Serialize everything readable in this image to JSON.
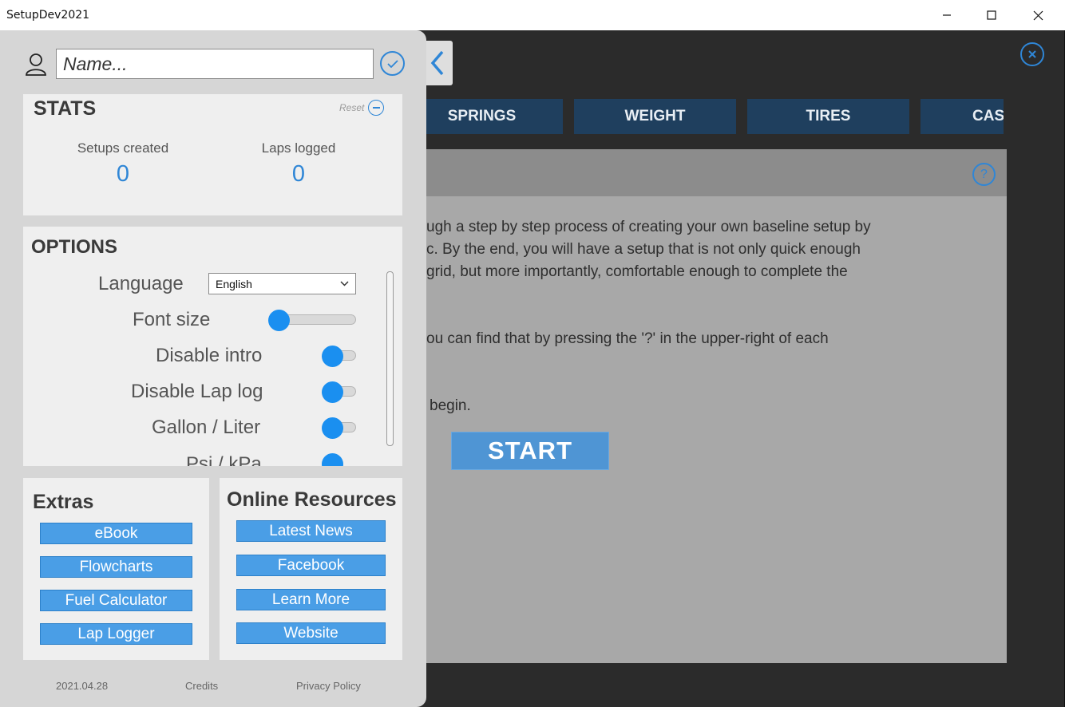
{
  "window": {
    "title": "SetupDev2021"
  },
  "panel": {
    "name_placeholder": "Name...",
    "stats": {
      "heading": "STATS",
      "reset_label": "Reset",
      "setups_label": "Setups created",
      "setups_value": "0",
      "laps_label": "Laps logged",
      "laps_value": "0"
    },
    "options": {
      "heading": "OPTIONS",
      "language_label": "Language",
      "language_value": "English",
      "font_size_label": "Font size",
      "font_size_level": 0,
      "disable_intro_label": "Disable intro",
      "disable_lap_log_label": "Disable Lap log",
      "gallon_liter_label": "Gallon / Liter",
      "partial_label": "Psi / kPa"
    },
    "extras": {
      "heading": "Extras",
      "buttons": [
        "eBook",
        "Flowcharts",
        "Fuel Calculator",
        "Lap Logger"
      ]
    },
    "online": {
      "heading": "Online Resources",
      "buttons": [
        "Latest News",
        "Facebook",
        "Learn More",
        "Website"
      ]
    },
    "footer": {
      "version": "2021.04.28",
      "credits": "Credits",
      "privacy": "Privacy Policy"
    }
  },
  "tabs": [
    "SPRINGS",
    "WEIGHT",
    "TIRES",
    "CAS"
  ],
  "content": {
    "lines": [
      "ugh a step by step process of creating your own baseline setup by",
      "c. By the end, you will have a setup that is not only quick enough",
      "grid, but more importantly, comfortable enough to complete the",
      "ou can find that by pressing the '?' in the upper-right of each",
      "begin."
    ],
    "help_label": "?",
    "start_label": "START"
  },
  "colors": {
    "accent": "#2f86d6",
    "tab_bg": "#1f3f5e",
    "button_bg": "#4a9ee6",
    "toggle_knob": "#1a8ff0"
  }
}
